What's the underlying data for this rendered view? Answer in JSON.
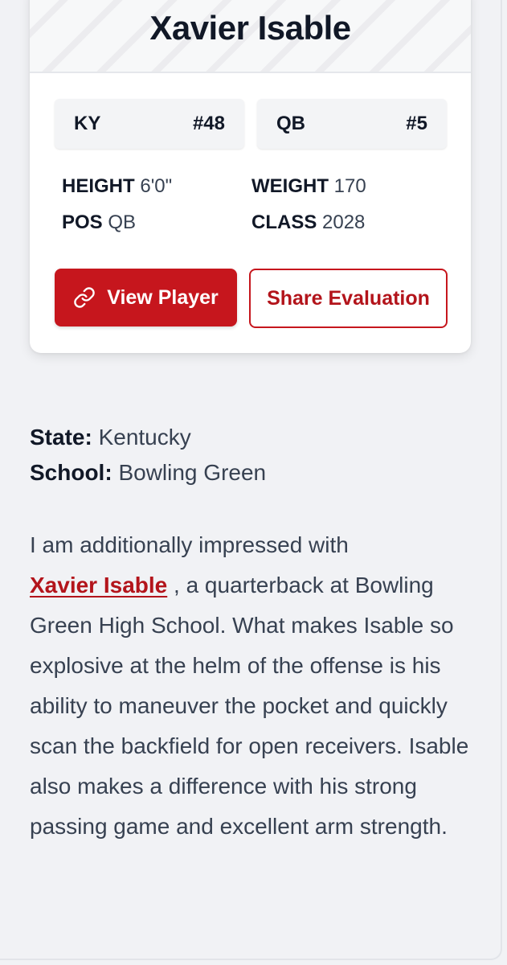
{
  "player": {
    "name": "Xavier Isable"
  },
  "badges": [
    {
      "left": "KY",
      "right": "#48"
    },
    {
      "left": "QB",
      "right": "#5"
    }
  ],
  "stats": {
    "height": {
      "label": "HEIGHT",
      "value": "6'0\""
    },
    "weight": {
      "label": "WEIGHT",
      "value": "170"
    },
    "pos": {
      "label": "POS",
      "value": "QB"
    },
    "class": {
      "label": "CLASS",
      "value": "2028"
    }
  },
  "actions": {
    "view_player": "View Player",
    "share_evaluation": "Share Evaluation",
    "view_player_icon": "link-icon"
  },
  "info": {
    "state_label": "State:",
    "state_value": "Kentucky",
    "school_label": "School:",
    "school_value": "Bowling Green"
  },
  "article": {
    "intro": "I am additionally impressed with",
    "link_text": "Xavier Isable",
    "body": ", a quarterback at Bowling Green High School. What makes Isable so explosive at the helm of the offense is his ability to maneuver the pocket and quickly scan the backfield for open receivers. Isable also makes a difference with his strong passing game and excellent arm strength."
  },
  "colors": {
    "accent": "#c6161d",
    "background": "#f1f2f5",
    "card": "#ffffff"
  }
}
